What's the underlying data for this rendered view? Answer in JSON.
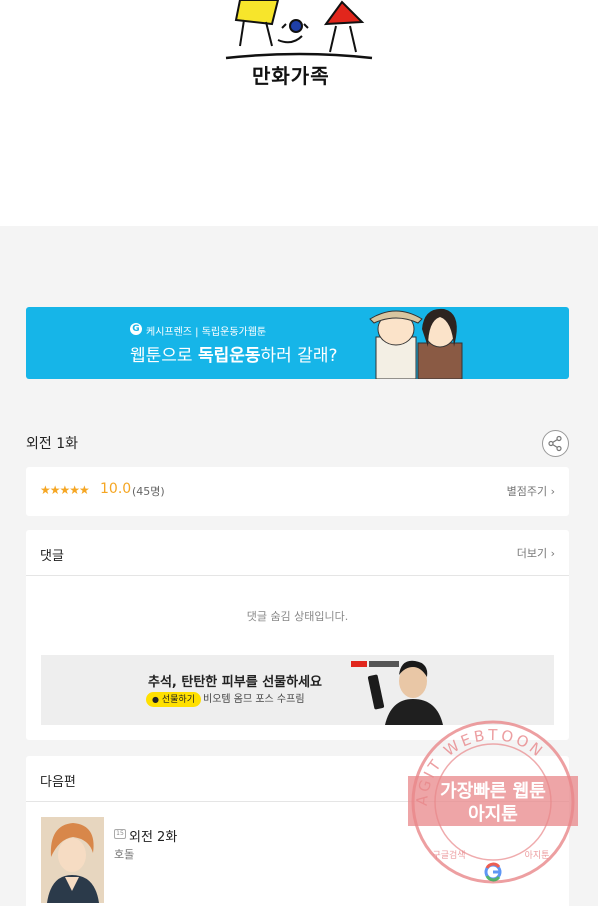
{
  "site": {
    "logo_text": "만화가족"
  },
  "banner": {
    "sub_brand": "케시프렌즈 | 독립운동가웹툰",
    "headline_pre": "웹툰으로 ",
    "headline_bold": "독립운동",
    "headline_post": "하러 갈래?"
  },
  "episode": {
    "title": "외전 1화"
  },
  "rating": {
    "stars": "★★★★★",
    "score": "10.0",
    "count": "(45명)",
    "rate_label": "별점주기 ›"
  },
  "comments": {
    "title": "댓글",
    "more_label": "더보기 ›",
    "hidden_message": "댓글 숨김 상태입니다."
  },
  "ad": {
    "title": "추석, 탄탄한 피부를 선물하세요",
    "badge": "선물하기",
    "desc": "비오템 옴므 포스 수프림"
  },
  "next": {
    "title": "다음편",
    "age_badge": "15",
    "episode": "외전 2화",
    "author": "호돌"
  },
  "watermark": {
    "ring_text": "AGIT WEBTOON",
    "line1": "가장빠른 웹툰",
    "line2": "아지툰",
    "bottom_left": "구글검색",
    "bottom_right": "아지툰",
    "color": "#e8878a"
  }
}
